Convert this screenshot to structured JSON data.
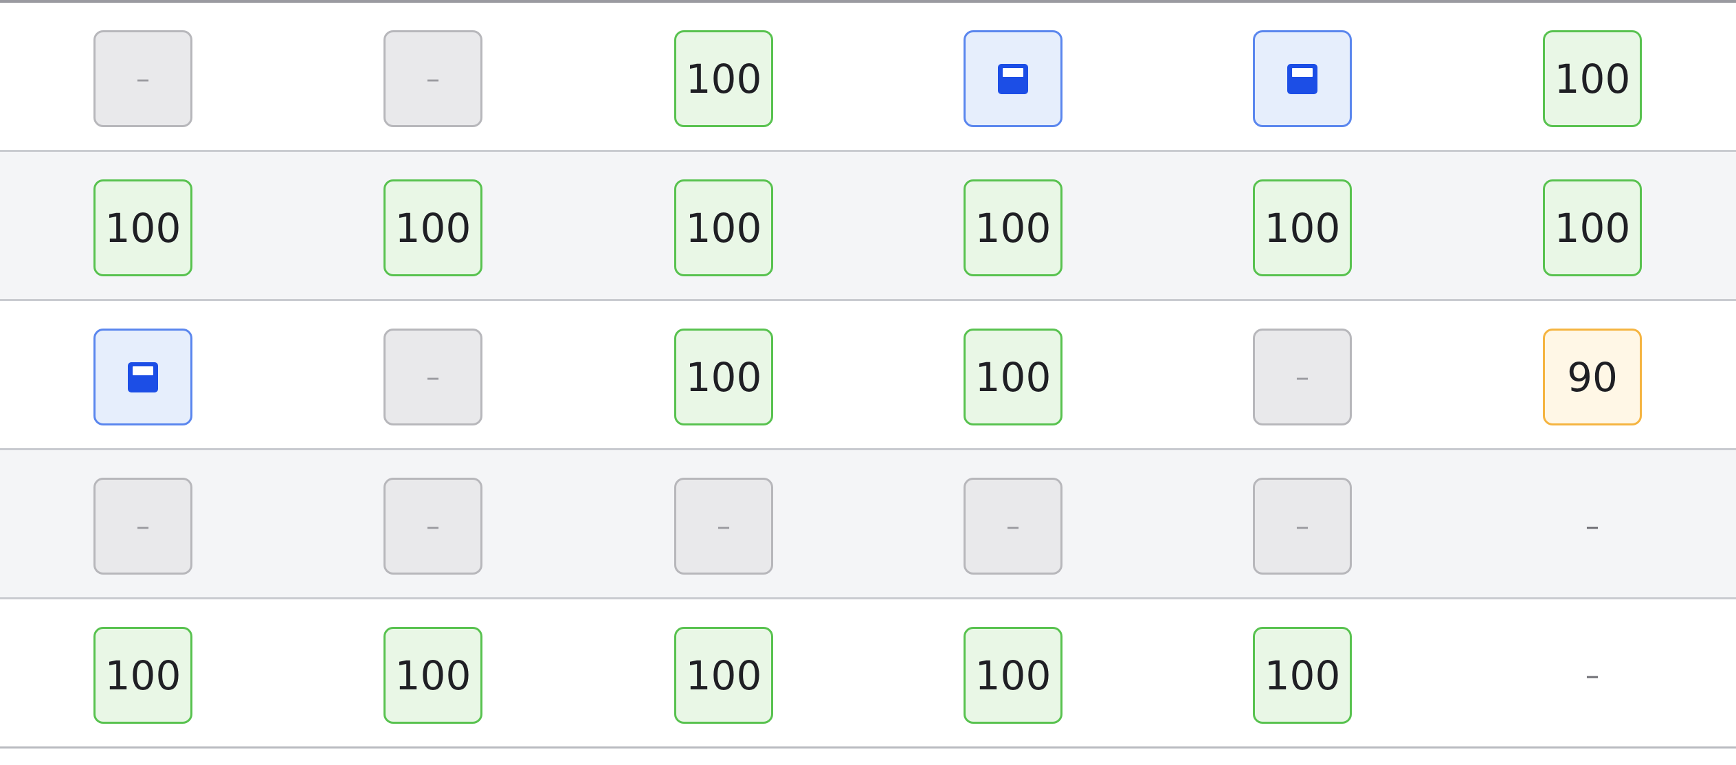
{
  "grid": {
    "colors": {
      "green_bg": "#e9f7e6",
      "green_border": "#58c24f",
      "orange_bg": "#fff7e6",
      "orange_border": "#f5b440",
      "blue_bg": "#e6eefc",
      "blue_border": "#5a86ee",
      "gray_bg": "#e9e9eb",
      "gray_border": "#b7b7bb"
    },
    "rows": [
      {
        "shaded": false,
        "cells": [
          {
            "type": "gray",
            "text": "–"
          },
          {
            "type": "gray",
            "text": "–"
          },
          {
            "type": "green",
            "text": "100"
          },
          {
            "type": "blue",
            "icon": "save-icon"
          },
          {
            "type": "blue",
            "icon": "save-icon"
          },
          {
            "type": "green",
            "text": "100"
          }
        ]
      },
      {
        "shaded": true,
        "cells": [
          {
            "type": "green",
            "text": "100"
          },
          {
            "type": "green",
            "text": "100"
          },
          {
            "type": "green",
            "text": "100"
          },
          {
            "type": "green",
            "text": "100"
          },
          {
            "type": "green",
            "text": "100"
          },
          {
            "type": "green",
            "text": "100"
          }
        ]
      },
      {
        "shaded": false,
        "cells": [
          {
            "type": "blue",
            "icon": "save-icon"
          },
          {
            "type": "gray",
            "text": "–"
          },
          {
            "type": "green",
            "text": "100"
          },
          {
            "type": "green",
            "text": "100"
          },
          {
            "type": "gray",
            "text": "–"
          },
          {
            "type": "orange",
            "text": "90"
          }
        ]
      },
      {
        "shaded": true,
        "cells": [
          {
            "type": "gray",
            "text": "–"
          },
          {
            "type": "gray",
            "text": "–"
          },
          {
            "type": "gray",
            "text": "–"
          },
          {
            "type": "gray",
            "text": "–"
          },
          {
            "type": "gray",
            "text": "–"
          },
          {
            "type": "plain",
            "text": "–"
          }
        ]
      },
      {
        "shaded": false,
        "cells": [
          {
            "type": "green",
            "text": "100"
          },
          {
            "type": "green",
            "text": "100"
          },
          {
            "type": "green",
            "text": "100"
          },
          {
            "type": "green",
            "text": "100"
          },
          {
            "type": "green",
            "text": "100"
          },
          {
            "type": "plain",
            "text": "–"
          }
        ]
      }
    ]
  }
}
